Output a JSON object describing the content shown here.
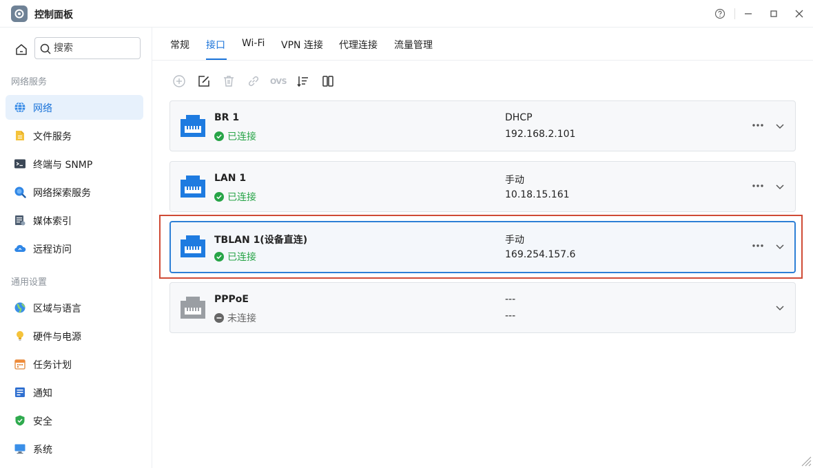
{
  "window": {
    "title": "控制面板"
  },
  "sidebar": {
    "search_placeholder": "搜索",
    "section_network": "网络服务",
    "section_general": "通用设置",
    "network_items": [
      {
        "label": "网络",
        "icon": "globe-icon"
      },
      {
        "label": "文件服务",
        "icon": "folder-icon"
      },
      {
        "label": "终端与 SNMP",
        "icon": "terminal-icon"
      },
      {
        "label": "网络探索服务",
        "icon": "magnifier-icon"
      },
      {
        "label": "媒体索引",
        "icon": "media-index-icon"
      },
      {
        "label": "远程访问",
        "icon": "cloud-icon"
      }
    ],
    "general_items": [
      {
        "label": "区域与语言",
        "icon": "region-globe-icon"
      },
      {
        "label": "硬件与电源",
        "icon": "lightbulb-icon"
      },
      {
        "label": "任务计划",
        "icon": "calendar-icon"
      },
      {
        "label": "通知",
        "icon": "notification-icon"
      },
      {
        "label": "安全",
        "icon": "shield-icon"
      },
      {
        "label": "系统",
        "icon": "monitor-icon"
      }
    ]
  },
  "tabs": [
    "常规",
    "接口",
    "Wi-Fi",
    "VPN 连接",
    "代理连接",
    "流量管理"
  ],
  "active_tab": "接口",
  "toolbar": [
    "add-icon",
    "edit-icon",
    "delete-icon",
    "link-icon",
    "ovs-icon",
    "sort-icon",
    "columns-icon"
  ],
  "toolbar_ovs_label": "OVS",
  "interfaces": [
    {
      "name": "BR 1",
      "status": "已连接",
      "connected": true,
      "mode": "DHCP",
      "ip": "192.168.2.101",
      "has_more": true
    },
    {
      "name": "LAN 1",
      "status": "已连接",
      "connected": true,
      "mode": "手动",
      "ip": "10.18.15.161",
      "has_more": true
    },
    {
      "name": "TBLAN 1(设备直连)",
      "status": "已连接",
      "connected": true,
      "mode": "手动",
      "ip": "169.254.157.6",
      "has_more": true,
      "selected": true
    },
    {
      "name": "PPPoE",
      "status": "未连接",
      "connected": false,
      "mode": "---",
      "ip": "---",
      "has_more": false
    }
  ],
  "colors": {
    "accent": "#1a73d9",
    "connected": "#27a447",
    "highlight": "#cf4a35",
    "port_active": "#1e7be0",
    "port_inactive": "#9a9ea3"
  }
}
